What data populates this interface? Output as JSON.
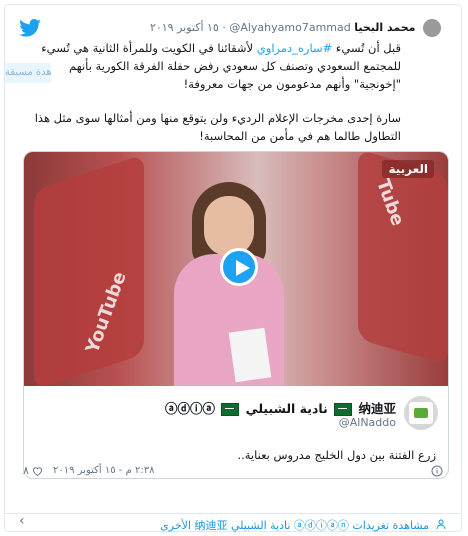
{
  "header": {
    "name": "محمد البحيا",
    "handle": "@Alyahyamo7ammad",
    "time": "١٥ أكتوبر ٢٠١٩"
  },
  "tweet": {
    "paragraph1_before": "قبل أن تُسيء ",
    "hashtag": "#ساره_دمراوي",
    "paragraph1_after": " لأشقائنا في الكويت وللمرأة الثانية هي تُسيء للمجتمع السعودي وتصنف كل سعودي رفض حفلة الفرقة الكورية بأنهم \"إخونجية\" وأنهم مدعومون من جهات معروفة!",
    "paragraph2": "سارة إحدى مخرجات الإعلام الرديء ولن يتوقع منها ومن أمثالها سوى مثل هذا التطاول طالما هم في مأمن من المحاسبة!"
  },
  "follow_ghost": "مشاهدة مسبقة",
  "video": {
    "channel": "العربية",
    "sign_left": "YouTube",
    "sign_right": "Tube"
  },
  "quoted": {
    "name": "نادية الشبيلي",
    "name_suffix": "ⓐⓓⓘⓐ",
    "name_cn": "纳迪亚",
    "handle": "@AlNaddo",
    "text": "زرع الفتنة بين دول الخليج مدروس بعناية..",
    "time": "٢:٣٨ م - ١٥ أكتوبر ٢٠١٩",
    "likes": "٨"
  },
  "footer": {
    "text": "مشاهدة تغريدات ⓐⓓⓘⓐⓝ نادية الشبيلي 纳迪亚 الأخرى"
  },
  "colors": {
    "link": "#1da1f2",
    "muted": "#657786",
    "border": "#e1e8ed"
  }
}
